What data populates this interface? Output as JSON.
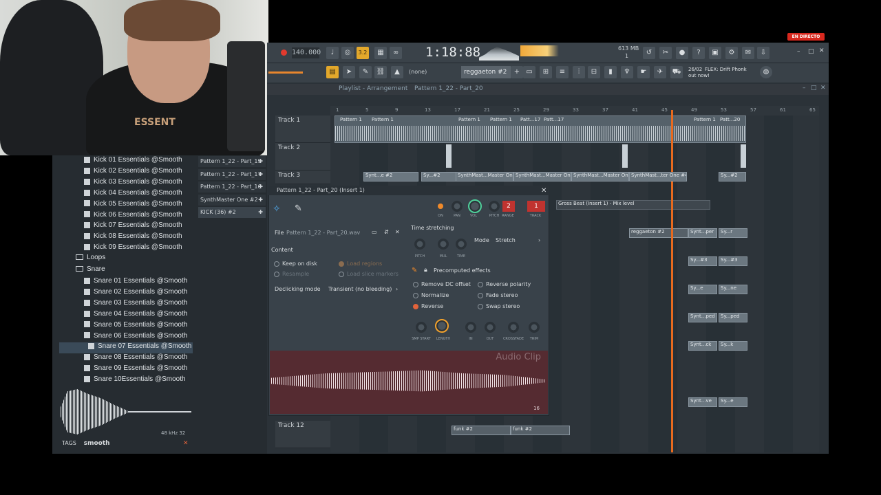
{
  "live_badge": "EN DIRECTO",
  "toolbar": {
    "tempo": "140.000",
    "pattern_num": "3.2",
    "time": "1:18:88",
    "cpu": "613 MB",
    "poly": "1",
    "snap": "(none)",
    "pattern_name": "reggaeton #2",
    "news_date": "26/02",
    "news_text": "FLEX: Drift Phonk",
    "news_text2": "out now!"
  },
  "playlist": {
    "title": "Playlist - Arrangement",
    "breadcrumb": "Pattern 1_22 - Part_20",
    "ruler": [
      "1",
      "5",
      "9",
      "13",
      "17",
      "21",
      "25",
      "29",
      "33",
      "37",
      "41",
      "45",
      "49",
      "53",
      "57",
      "61",
      "65"
    ],
    "tracks": [
      {
        "label": "Track 1"
      },
      {
        "label": "Track 2"
      },
      {
        "label": "Track 3"
      },
      {
        "label": "Track 12"
      }
    ],
    "clips_track1": [
      "Pattern 1",
      "Pattern 1",
      "Pattern 1",
      "Pattern 1",
      "Patt...17",
      "Patt...17",
      "Pattern 1",
      "Patt...20"
    ],
    "clips_track3": [
      "Synt...e #2",
      "Sy...#2",
      "SynthMast...Master One",
      "SynthMast...Master One",
      "SynthMast...Master One",
      "SynthMast...ter One #4",
      "Sy...#2"
    ],
    "clips_track12": [
      "funk #2",
      "funk #2"
    ],
    "mix_clip": "Gross Beat (Insert 1) - Mix level",
    "reggaeton_clip": "reggaeton #2",
    "misc_clips": [
      "Synt...per",
      "Sy...r",
      "Sy...#3",
      "Sy...#3",
      "Sy...e",
      "Sy...ne",
      "Synt...ped",
      "Sy...ped",
      "Synt...ck",
      "Sy...k",
      "Synt...ve",
      "Sy...e"
    ]
  },
  "browser": {
    "kicks": [
      "Kick 01 Essentials @Smooth",
      "Kick 02 Essentials @Smooth",
      "Kick 03 Essentials @Smooth",
      "Kick 04 Essentials @Smooth",
      "Kick 05 Essentials @Smooth",
      "Kick 06 Essentials @Smooth",
      "Kick 07 Essentials @Smooth",
      "Kick 08 Essentials @Smooth",
      "Kick 09 Essentials @Smooth"
    ],
    "folder_loops": "Loops",
    "folder_snare": "Snare",
    "snares": [
      "Snare 01 Essentials @Smooth",
      "Snare 02 Essentials @Smooth",
      "Snare 03 Essentials @Smooth",
      "Snare 04 Essentials @Smooth",
      "Snare 05 Essentials @Smooth",
      "Snare 06 Essentials @Smooth",
      "Snare 07 Essentials @Smooth",
      "Snare 08 Essentials @Smooth",
      "Snare 09 Essentials @Smooth",
      "Snare 10Essentials @Smooth"
    ],
    "sample_info": "48 kHz 32",
    "tags_label": "TAGS",
    "tags_value": "smooth"
  },
  "patterns": [
    "Pattern 1_22 - Part_19",
    "Pattern 1_22 - Part_17",
    "Pattern 1_22 - Part_16",
    "SynthMaster One #2 -",
    "KICK (36) #2"
  ],
  "sample_panel": {
    "title": "Pattern 1_22 - Part_20 (Insert 1)",
    "file_label": "File",
    "file_name": "Pattern 1_22 - Part_20.wav",
    "content_label": "Content",
    "keep_on_disk": "Keep on disk",
    "resample": "Resample",
    "load_regions": "Load regions",
    "load_slice_markers": "Load slice markers",
    "declicking_label": "Declicking mode",
    "declicking_value": "Transient (no bleeding)",
    "time_stretching": "Time stretching",
    "mode_label": "Mode",
    "mode_value": "Stretch",
    "pitch_lbl": "PITCH",
    "mul_lbl": "MUL",
    "time_lbl": "TIME",
    "channel_num": "2",
    "track_num": "1",
    "on_lbl": "ON",
    "pan_lbl": "PAN",
    "vol_lbl": "VOL",
    "pitch2_lbl": "PITCH",
    "range_lbl": "RANGE",
    "track_lbl": "TRACK",
    "precomputed": "Precomputed effects",
    "remove_dc": "Remove DC offset",
    "normalize": "Normalize",
    "reverse": "Reverse",
    "reverse_polarity": "Reverse polarity",
    "fade_stereo": "Fade stereo",
    "swap_stereo": "Swap stereo",
    "knobs": [
      "SMP START",
      "LENGTH",
      "IN",
      "OUT",
      "CROSSFADE",
      "TRIM"
    ],
    "audio_clip_label": "Audio Clip",
    "bits": "16"
  }
}
